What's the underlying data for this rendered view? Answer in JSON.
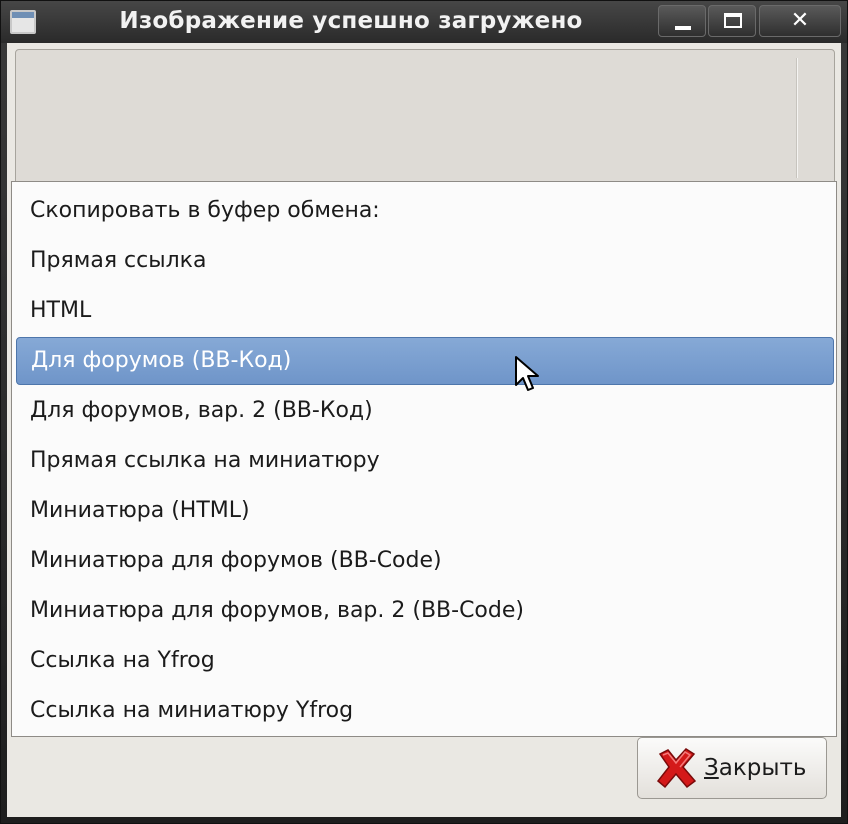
{
  "window": {
    "title": "Изображение успешно загружено"
  },
  "titlebar_buttons": {
    "close_glyph": "✕"
  },
  "menu": {
    "items": [
      {
        "label": "Скопировать в буфер обмена:",
        "highlighted": false
      },
      {
        "label": "Прямая ссылка",
        "highlighted": false
      },
      {
        "label": "HTML",
        "highlighted": false
      },
      {
        "label": "Для форумов (BB-Код)",
        "highlighted": true
      },
      {
        "label": "Для форумов, вар. 2 (BB-Код)",
        "highlighted": false
      },
      {
        "label": "Прямая ссылка на миниатюру",
        "highlighted": false
      },
      {
        "label": "Миниатюра (HTML)",
        "highlighted": false
      },
      {
        "label": "Миниатюра для форумов (BB-Code)",
        "highlighted": false
      },
      {
        "label": "Миниатюра для форумов, вар. 2 (BB-Code)",
        "highlighted": false
      },
      {
        "label": "Ссылка на Yfrog",
        "highlighted": false
      },
      {
        "label": "Ссылка на миниатюру Yfrog",
        "highlighted": false
      }
    ]
  },
  "footer": {
    "close_mnemonic": "З",
    "close_rest": "акрыть",
    "close_icon": "x-icon"
  },
  "colors": {
    "highlight": "#7aa0d0",
    "close_icon_red": "#d41919"
  }
}
